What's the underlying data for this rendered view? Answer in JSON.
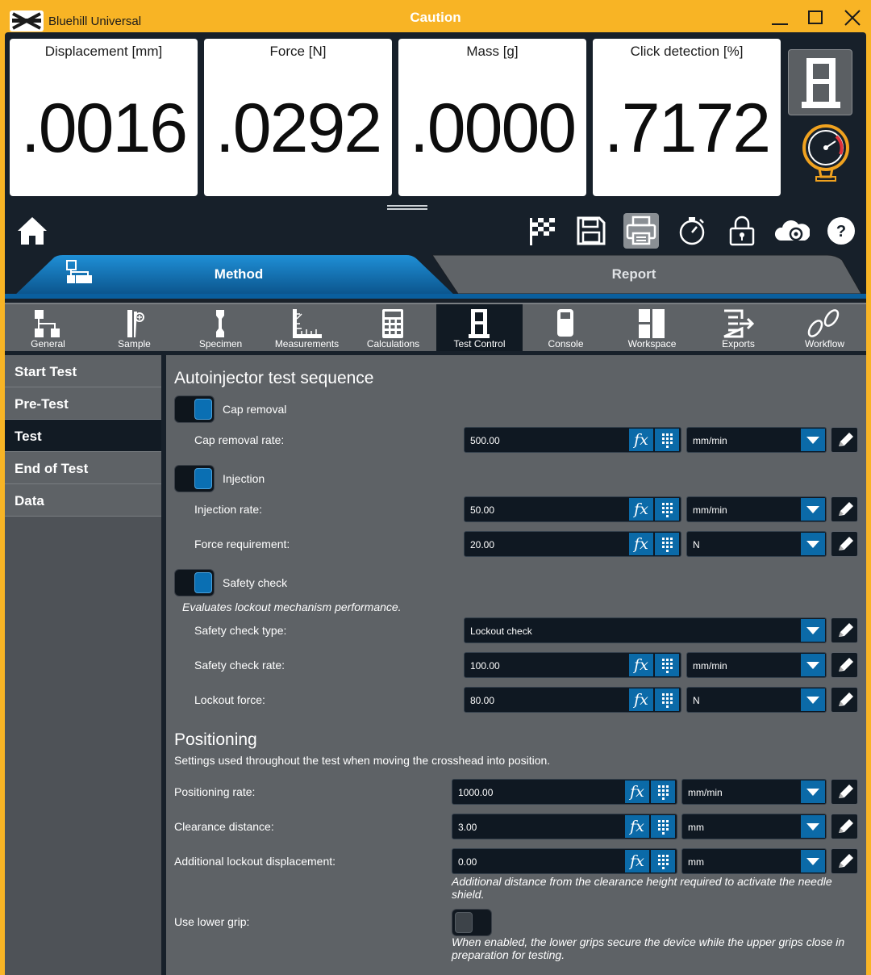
{
  "app": {
    "title": "Bluehill Universal",
    "banner": "Caution"
  },
  "readouts": [
    {
      "label": "Displacement [mm]",
      "value": ".0016"
    },
    {
      "label": "Force [N]",
      "value": ".0292"
    },
    {
      "label": "Mass [g]",
      "value": ".0000"
    },
    {
      "label": "Click detection [%]",
      "value": ".7172"
    }
  ],
  "tabs": {
    "method": "Method",
    "report": "Report",
    "active": "Method"
  },
  "subtabs": [
    {
      "label": "General"
    },
    {
      "label": "Sample"
    },
    {
      "label": "Specimen"
    },
    {
      "label": "Measurements"
    },
    {
      "label": "Calculations"
    },
    {
      "label": "Test Control",
      "active": true
    },
    {
      "label": "Console"
    },
    {
      "label": "Workspace"
    },
    {
      "label": "Exports"
    },
    {
      "label": "Workflow"
    }
  ],
  "sidebar": [
    {
      "label": "Start Test"
    },
    {
      "label": "Pre-Test"
    },
    {
      "label": "Test",
      "active": true
    },
    {
      "label": "End of Test"
    },
    {
      "label": "Data"
    }
  ],
  "autoinjector": {
    "title": "Autoinjector test sequence",
    "cap_removal": {
      "toggle_label": "Cap removal",
      "enabled": true,
      "rate_label": "Cap removal rate:",
      "rate_value": "500.00",
      "rate_unit": "mm/min"
    },
    "injection": {
      "toggle_label": "Injection",
      "enabled": true,
      "rate_label": "Injection rate:",
      "rate_value": "50.00",
      "rate_unit": "mm/min",
      "force_label": "Force requirement:",
      "force_value": "20.00",
      "force_unit": "N"
    },
    "safety": {
      "toggle_label": "Safety check",
      "enabled": true,
      "note": "Evaluates lockout mechanism performance.",
      "type_label": "Safety check type:",
      "type_value": "Lockout check",
      "rate_label": "Safety check rate:",
      "rate_value": "100.00",
      "rate_unit": "mm/min",
      "force_label": "Lockout force:",
      "force_value": "80.00",
      "force_unit": "N"
    }
  },
  "positioning": {
    "title": "Positioning",
    "description": "Settings used throughout the test when moving the crosshead into position.",
    "rate_label": "Positioning rate:",
    "rate_value": "1000.00",
    "rate_unit": "mm/min",
    "clearance_label": "Clearance distance:",
    "clearance_value": "3.00",
    "clearance_unit": "mm",
    "lockout_label": "Additional lockout displacement:",
    "lockout_value": "0.00",
    "lockout_unit": "mm",
    "lockout_note": "Additional distance from the clearance height required to activate the needle shield.",
    "grip_label": "Use lower grip:",
    "grip_enabled": false,
    "grip_note": "When enabled, the lower grips secure the device while the upper grips close in preparation for testing."
  },
  "colors": {
    "accent": "#0b6aa8",
    "caution": "#f8b425",
    "frame": "#17202a",
    "panel": "#5e6266"
  }
}
